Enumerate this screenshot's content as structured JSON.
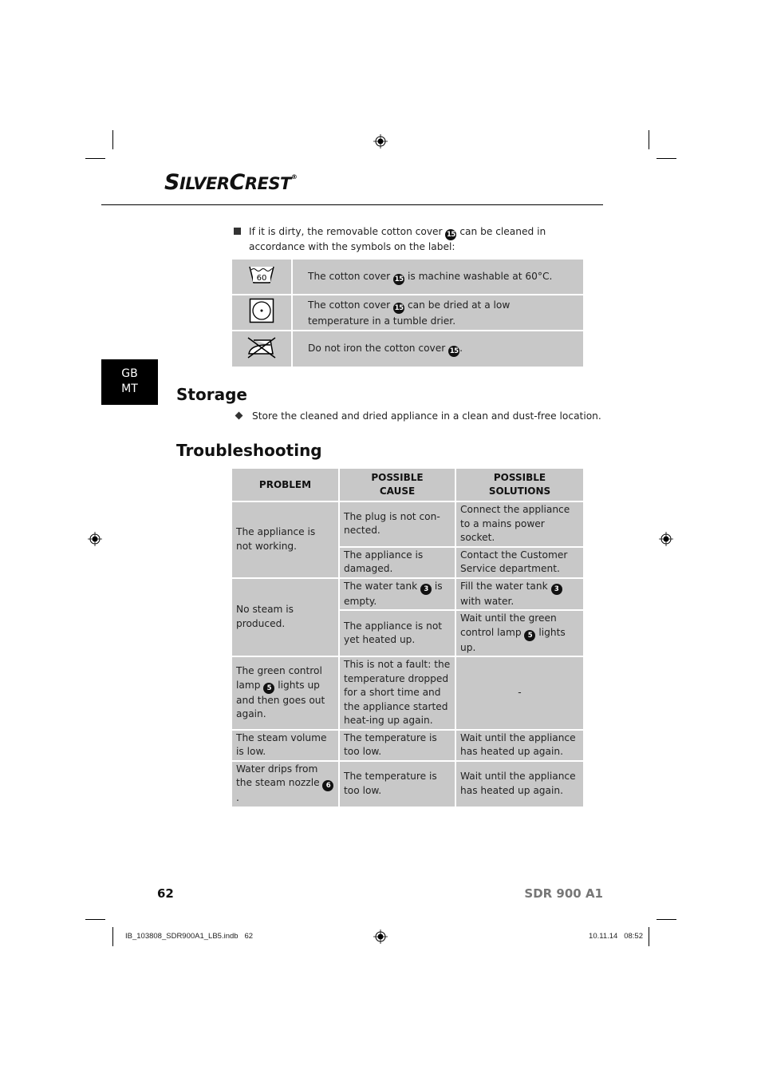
{
  "header": {
    "brand_first_big": "S",
    "brand_first_rest": "ILVER",
    "brand_second_big": "C",
    "brand_second_rest": "REST",
    "brand_registered": "®"
  },
  "language_tab": {
    "line1": "GB",
    "line2": "MT"
  },
  "cleaning": {
    "intro_before": "If it is dirty, the removable cotton cover",
    "intro_ref": "15",
    "intro_after": "can be cleaned in accordance with the symbols on the label:",
    "symbols": [
      {
        "icon": "wash-60-icon",
        "symbol_text": "60",
        "text_before": "The cotton cover",
        "ref": "15",
        "text_after": "is machine washable at 60°C."
      },
      {
        "icon": "tumble-dry-low-icon",
        "text_before": "The cotton cover",
        "ref": "15",
        "text_after": "can be dried at a low temperature in a tumble drier."
      },
      {
        "icon": "do-not-iron-icon",
        "text_before": "Do not iron the cotton cover",
        "ref": "15",
        "text_after": "."
      }
    ]
  },
  "storage": {
    "heading": "Storage",
    "bullet": "Store the cleaned and dried appliance in a clean and dust-free location."
  },
  "troubleshooting": {
    "heading": "Troubleshooting",
    "columns": {
      "problem": "PROBLEM",
      "cause_line1": "POSSIBLE",
      "cause_line2": "CAUSE",
      "solution_line1": "POSSIBLE",
      "solution_line2": "SOLUTIONS"
    },
    "rows": [
      {
        "problem": "The appliance is not working.",
        "cause": "The plug is not con-nected.",
        "solution": "Connect the appliance to a mains power socket."
      },
      {
        "cause": "The appliance is damaged.",
        "solution": "Contact the Customer Service department."
      },
      {
        "problem": "No steam is produced.",
        "cause_before": "The water tank",
        "cause_ref": "3",
        "cause_after": "is empty.",
        "solution_before": "Fill the water tank",
        "solution_ref": "3",
        "solution_after": "with water."
      },
      {
        "cause": "The appliance is not yet heated up.",
        "solution_before": "Wait until the green control lamp",
        "solution_ref": "5",
        "solution_after": "lights up."
      },
      {
        "problem_before": "The green control lamp",
        "problem_ref": "5",
        "problem_after": "lights up and then goes out again.",
        "cause": "This is not a fault: the temperature dropped for a short time and the appliance started heat-ing up again.",
        "solution": "-"
      },
      {
        "problem": "The steam volume is low.",
        "cause": "The temperature is too low.",
        "solution": "Wait until the appliance has heated up again."
      },
      {
        "problem_before": "Water drips from the steam nozzle",
        "problem_ref": "6",
        "problem_after": ".",
        "cause": "The temperature is too low.",
        "solution": "Wait until the appliance has heated up again."
      }
    ]
  },
  "footer": {
    "page_number": "62",
    "model": "SDR 900 A1",
    "slug_file": "IB_103808_SDR900A1_LB5.indb   62",
    "slug_date": "10.11.14   08:52"
  }
}
